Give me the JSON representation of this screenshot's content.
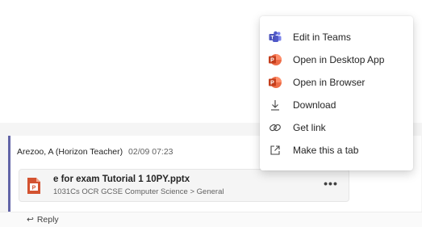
{
  "menu": {
    "items": [
      {
        "label": "Edit in Teams",
        "icon": "teams-icon"
      },
      {
        "label": "Open in Desktop App",
        "icon": "powerpoint-icon"
      },
      {
        "label": "Open in Browser",
        "icon": "powerpoint-icon"
      },
      {
        "label": "Download",
        "icon": "download-icon"
      },
      {
        "label": "Get link",
        "icon": "link-icon"
      },
      {
        "label": "Make this a tab",
        "icon": "open-tab-icon"
      }
    ]
  },
  "post": {
    "author": "Arezoo, A (Horizon Teacher)",
    "timestamp": "02/09 07:23",
    "attachment": {
      "file_name": "e for exam Tutorial 1 10PY.pptx",
      "path": "1031Cs OCR GCSE Computer Science > General",
      "more_label": "•••"
    },
    "reply_label": "Reply"
  },
  "colors": {
    "accent": "#6264a7",
    "powerpoint": "#d35230",
    "teams": "#5059c9"
  }
}
